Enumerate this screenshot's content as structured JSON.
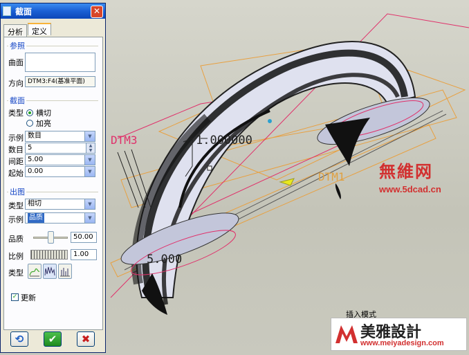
{
  "dialog": {
    "title": "截面",
    "close_symbol": "✕",
    "tabs": [
      "分析",
      "定义"
    ],
    "active_tab": "定义",
    "reference": {
      "group_title": "参照",
      "surface_label": "曲面",
      "direction_label": "方向",
      "direction_value": "DTM3:F4(基准平面)"
    },
    "section": {
      "group_title": "截面",
      "type_label": "类型",
      "type_options": [
        "横切",
        "加亮"
      ],
      "type_selected": "横切",
      "instance_label": "示例",
      "instance_value": "数目",
      "count_label": "数目",
      "count_value": "5",
      "spacing_label": "间距",
      "spacing_value": "5.00",
      "start_label": "起始",
      "start_value": "0.00"
    },
    "output": {
      "group_title": "出图",
      "type_label": "类型",
      "type_value": "相切",
      "instance_label": "示例",
      "instance_value": "品质",
      "quality_label": "品质",
      "quality_value": "50.00",
      "quality_level": 0.5,
      "scale_label": "比例",
      "scale_value": "1.00",
      "kind_label": "类型"
    },
    "update_label": "更新",
    "update_checked": true
  },
  "viewport": {
    "dtm3_label": "DTM3",
    "dtm1_label": "DTM1",
    "dim_top": "1.000000",
    "dim_bottom": "5.000"
  },
  "watermarks": {
    "brand_cn": "無維网",
    "brand_url": "www.5dcad.cn",
    "insert_mode": "插入模式",
    "meiya_cn": "美雅設計",
    "meiya_url": "www.meiyadesign.com"
  },
  "colors": {
    "title_bar": "#1a5fd4",
    "group_title": "#1546c5",
    "datum_line": "#e0306a",
    "datum_plane": "#e8a040",
    "watermark_red": "#d23030"
  }
}
